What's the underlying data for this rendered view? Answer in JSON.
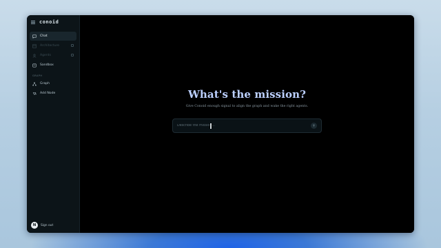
{
  "app": {
    "name": "conoid"
  },
  "sidebar": {
    "items": [
      {
        "label": "Chat",
        "icon": "chat-bubble-icon",
        "active": true
      },
      {
        "label": "Architecture",
        "icon": "layout-icon",
        "active": false,
        "disabled": true
      },
      {
        "label": "Agents",
        "icon": "agents-icon",
        "active": false,
        "disabled": true
      },
      {
        "label": "Sandbox",
        "icon": "sandbox-icon",
        "active": false
      }
    ],
    "section_label": "GRAPH",
    "graph_items": [
      {
        "label": "Graph",
        "icon": "graph-icon"
      },
      {
        "label": "Add Node",
        "icon": "add-node-icon"
      }
    ],
    "user": {
      "avatar_letter": "N",
      "signout_label": "Sign out"
    }
  },
  "main": {
    "title": "What's the mission?",
    "subtitle": "Give Conoid enough signal to align the graph and wake the right agents.",
    "prompt": {
      "placeholder": "Describe the mission...",
      "value": ""
    }
  },
  "colors": {
    "accent_title": "#bcd0ff",
    "window_bg": "#000000",
    "sidebar_bg": "#0c1418",
    "active_item_bg": "#19262d"
  }
}
